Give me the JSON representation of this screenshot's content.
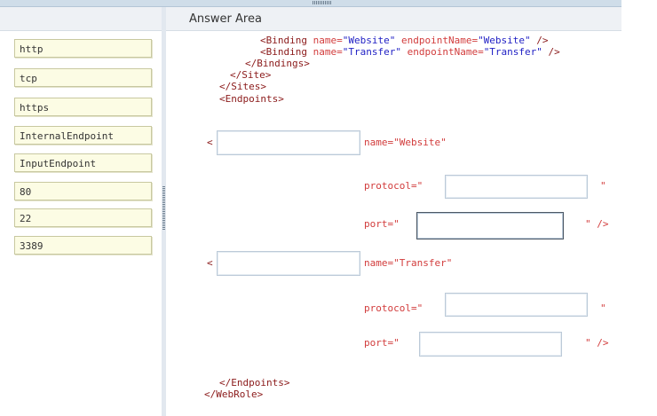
{
  "answer_area": {
    "title": "Answer Area"
  },
  "choices": [
    "http",
    "tcp",
    "https",
    "InternalEndpoint",
    "InputEndpoint",
    "80",
    "22",
    "3389"
  ],
  "code": {
    "binding1": {
      "tag": "<Binding",
      "name_attr": "name=",
      "name_val": "\"Website\"",
      "ep_attr": "endpointName=",
      "ep_val": "\"Website\"",
      "close": "/>"
    },
    "binding2": {
      "tag": "<Binding",
      "name_attr": "name=",
      "name_val": "\"Transfer\"",
      "ep_attr": "endpointName=",
      "ep_val": "\"Transfer\"",
      "close": "/>"
    },
    "bindings_close": "</Bindings>",
    "site_close": "</Site>",
    "sites_close": "</Sites>",
    "endpoints_open": "<Endpoints>",
    "lt": "<",
    "ep1_name": "name=\"Website\"",
    "ep2_name": "name=\"Transfer\"",
    "protocol": "protocol=\"",
    "port": "port=\"",
    "quote": "\"",
    "quote_close": "\" />",
    "endpoints_close": "</Endpoints>",
    "webrole_close": "</WebRole>"
  }
}
